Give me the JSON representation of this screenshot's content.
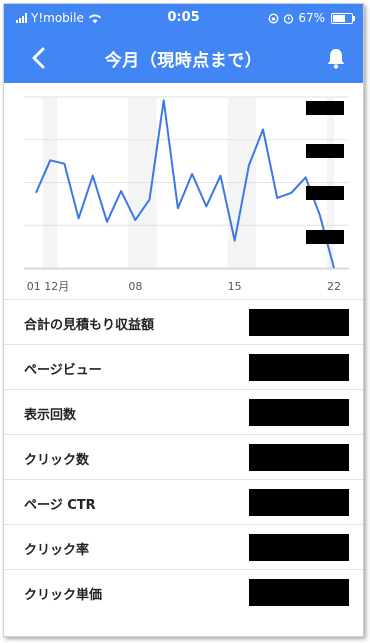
{
  "status_bar": {
    "carrier": "Y!mobile",
    "time": "0:05",
    "battery": "67%"
  },
  "header": {
    "title": "今月（現時点まで）"
  },
  "chart_data": {
    "type": "line",
    "color": "#3b78e7",
    "x_tick_labels": [
      "01 12月",
      "08",
      "15",
      "22"
    ],
    "x_tick_days": [
      1,
      8,
      15,
      22
    ],
    "x": [
      1,
      2,
      3,
      4,
      5,
      6,
      7,
      8,
      9,
      10,
      11,
      12,
      13,
      14,
      15,
      16,
      17,
      18,
      19,
      20,
      21,
      22
    ],
    "values": [
      44,
      63,
      61,
      29,
      54,
      27,
      45,
      28,
      40,
      98,
      35,
      55,
      36,
      54,
      16,
      60,
      81,
      41,
      44,
      53,
      31,
      0
    ],
    "ylim": [
      0,
      100
    ],
    "grid": true
  },
  "metrics": [
    {
      "label": "合計の見積もり収益額"
    },
    {
      "label": "ページビュー"
    },
    {
      "label": "表示回数"
    },
    {
      "label": "クリック数"
    },
    {
      "label": "ページ CTR"
    },
    {
      "label": "クリック率"
    },
    {
      "label": "クリック単価"
    }
  ]
}
